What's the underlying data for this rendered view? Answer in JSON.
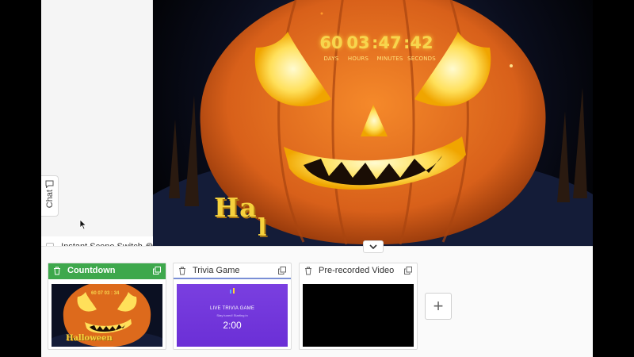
{
  "chat": {
    "label": "Chat"
  },
  "countdown": {
    "days": "60",
    "hours": "03",
    "minutes": "47",
    "seconds": "42",
    "days_label": "DAYS",
    "hours_label": "HOURS",
    "minutes_label": "MINUTES",
    "seconds_label": "SECONDS"
  },
  "overlay": {
    "text_main": "Ha",
    "text_tail": "l"
  },
  "instant_switch": {
    "label": "Instant Scene Switch"
  },
  "scenes": [
    {
      "name": "Countdown",
      "active": true,
      "thumb": {
        "time": "60 07 03 : 34",
        "caption": "Halloween"
      }
    },
    {
      "name": "Trivia Game",
      "active": false,
      "thumb": {
        "title": "LIVE TRIVIA GAME",
        "subtitle": "Stay tuned! Starting in",
        "time": "2:00"
      }
    },
    {
      "name": "Pre-recorded Video",
      "active": false
    }
  ],
  "colors": {
    "accent_green": "#3ea84c",
    "pumpkin": "#e8701c",
    "gold": "#f6d23d",
    "trivia_purple": "#7a3fe0"
  },
  "icons": [
    "chat-icon",
    "help-icon",
    "trash-icon",
    "duplicate-icon",
    "plus-icon",
    "chevron-down-icon",
    "cursor-arrow-icon"
  ]
}
